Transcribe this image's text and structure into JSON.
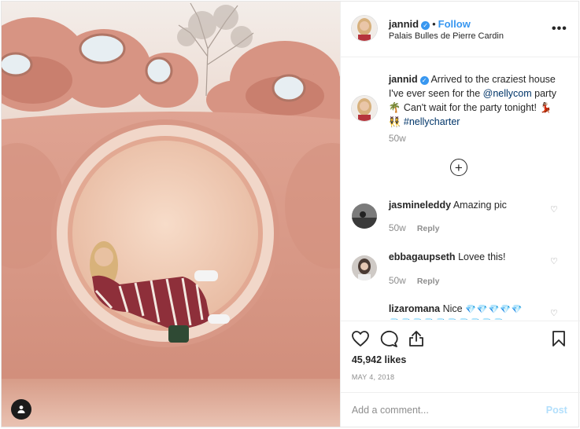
{
  "post": {
    "username": "jannid",
    "follow_label": "Follow",
    "separator": "•",
    "location": "Palais Bulles de Pierre Cardin",
    "more_icon": "more-horizontal-icon",
    "verified_icon": "verified-badge-icon"
  },
  "caption": {
    "username": "jannid",
    "text_1": "Arrived to the craziest house I've ever seen for the",
    "mention": "@nellycom",
    "text_2": "party 🌴 Can't wait for the party tonight! 💃🏽👯‍♀️",
    "hashtag": "#nellycharter",
    "time": "50w"
  },
  "load_more_icon": "plus-circle-icon",
  "comments": [
    {
      "username": "jasmineleddy",
      "text": "Amazing pic",
      "time": "50w",
      "reply_label": "Reply"
    },
    {
      "username": "ebbagaupseth",
      "text": "Lovee this!",
      "time": "50w",
      "reply_label": "Reply"
    },
    {
      "username": "lizaromana",
      "text": "Nice",
      "emojis": "💎💎💎💎💎",
      "emojis_2": "💎💎💎💎💎💎💎💎💎💎"
    }
  ],
  "actions": {
    "icons": [
      "heart-icon",
      "comment-icon",
      "share-icon",
      "bookmark-icon"
    ],
    "likes": "45,942 likes",
    "date": "MAY 4, 2018"
  },
  "add_comment": {
    "placeholder": "Add a comment...",
    "post_label": "Post"
  },
  "colors": {
    "accent": "#3897f0",
    "link": "#003569",
    "muted": "#8e8e8e",
    "post_disabled": "#b2dffc",
    "wall": "#d99a86"
  }
}
